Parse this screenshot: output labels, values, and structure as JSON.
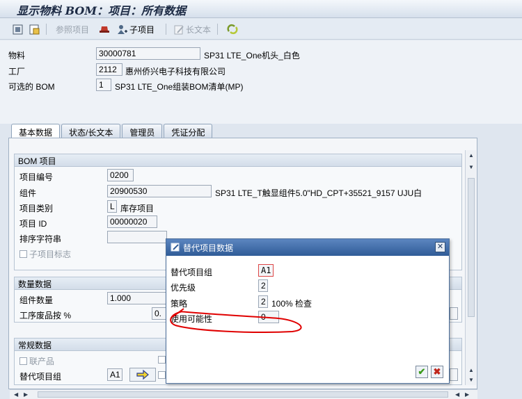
{
  "window": {
    "title": "显示物料 BOM：项目：所有数据"
  },
  "toolbar": {
    "ref_item": "参照项目",
    "sub_item": "子项目",
    "long_text": "长文本"
  },
  "header": {
    "material_label": "物料",
    "material_value": "30000781",
    "material_desc": "SP31 LTE_One机头_白色",
    "plant_label": "工厂",
    "plant_value": "2112",
    "plant_desc": "惠州侨兴电子科技有限公司",
    "alt_bom_label": "可选的 BOM",
    "alt_bom_value": "1",
    "alt_bom_desc": "SP31 LTE_One组装BOM清单(MP)"
  },
  "tabs": [
    {
      "label": "基本数据",
      "active": true
    },
    {
      "label": "状态/长文本"
    },
    {
      "label": "管理员"
    },
    {
      "label": "凭证分配"
    }
  ],
  "bom_item": {
    "title": "BOM 项目",
    "item_no_label": "项目编号",
    "item_no": "0200",
    "component_label": "组件",
    "component": "20900530",
    "component_desc": "SP31 LTE_T触显组件5.0\"HD_CPT+35521_9157 UJU白",
    "item_cat_label": "项目类别",
    "item_cat": "L",
    "item_cat_desc": "库存项目",
    "item_id_label": "项目 ID",
    "item_id": "00000020",
    "sort_label": "排序字符串",
    "sort_value": "",
    "subitem_flag_label": "子项目标志"
  },
  "qty_data": {
    "title": "数量数据",
    "comp_qty_label": "组件数量",
    "comp_qty": "1.000",
    "scrap_label": "工序废品按 %",
    "scrap_value": "0."
  },
  "general": {
    "title": "常规数据",
    "coproduct_label": "联产品",
    "alt_group_label": "替代项目组",
    "alt_group_value": "A1"
  },
  "dialog": {
    "title": "替代项目数据",
    "alt_group_label": "替代项目组",
    "alt_group_value": "A1",
    "priority_label": "优先级",
    "priority_value": "2",
    "strategy_label": "策略",
    "strategy_value": "2",
    "strategy_desc": "100% 检查",
    "usage_prob_label": "使用可能性",
    "usage_prob_value": "0"
  },
  "colors": {
    "annotation": "#e00000",
    "titlebar": "#2f5b97"
  }
}
